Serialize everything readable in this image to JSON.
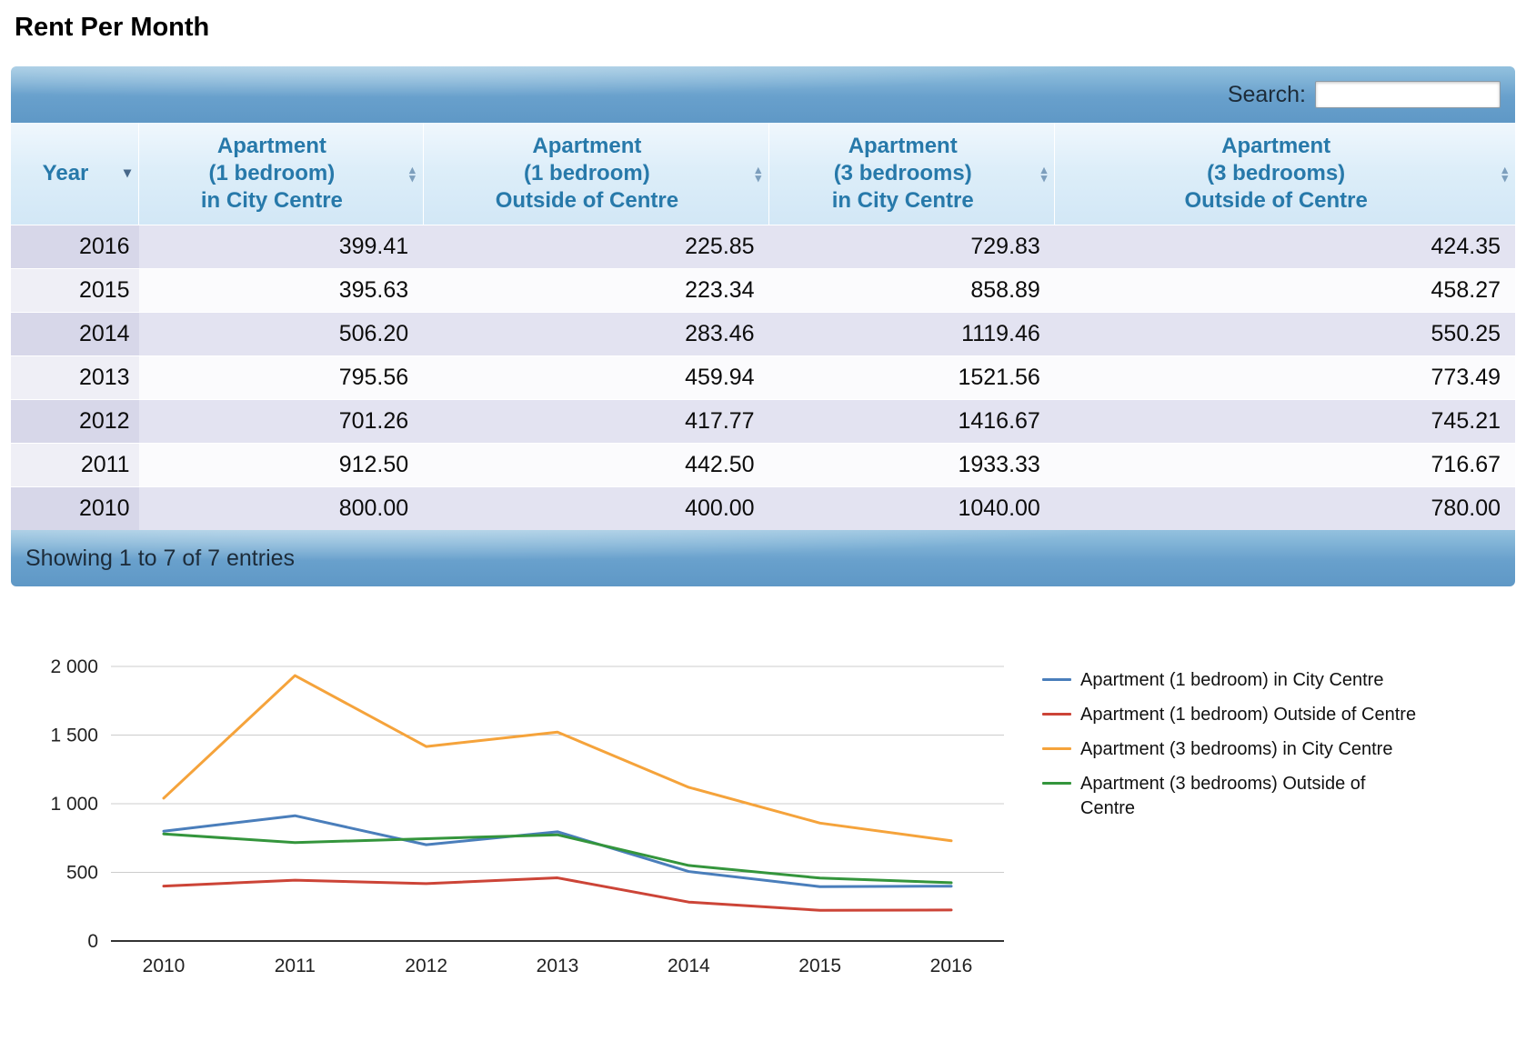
{
  "page": {
    "title": "Rent Per Month"
  },
  "table": {
    "search_label": "Search:",
    "search_value": "",
    "columns": [
      {
        "label": "Year",
        "sort": "desc"
      },
      {
        "label": "Apartment\n(1 bedroom)\nin City Centre",
        "sort": "none"
      },
      {
        "label": "Apartment\n(1 bedroom)\nOutside of Centre",
        "sort": "none"
      },
      {
        "label": "Apartment\n(3 bedrooms)\nin City Centre",
        "sort": "none"
      },
      {
        "label": "Apartment\n(3 bedrooms)\nOutside of Centre",
        "sort": "none"
      }
    ],
    "rows": [
      {
        "year": "2016",
        "values": [
          "399.41",
          "225.85",
          "729.83",
          "424.35"
        ]
      },
      {
        "year": "2015",
        "values": [
          "395.63",
          "223.34",
          "858.89",
          "458.27"
        ]
      },
      {
        "year": "2014",
        "values": [
          "506.20",
          "283.46",
          "1119.46",
          "550.25"
        ]
      },
      {
        "year": "2013",
        "values": [
          "795.56",
          "459.94",
          "1521.56",
          "773.49"
        ]
      },
      {
        "year": "2012",
        "values": [
          "701.26",
          "417.77",
          "1416.67",
          "745.21"
        ]
      },
      {
        "year": "2011",
        "values": [
          "912.50",
          "442.50",
          "1933.33",
          "716.67"
        ]
      },
      {
        "year": "2010",
        "values": [
          "800.00",
          "400.00",
          "1040.00",
          "780.00"
        ]
      }
    ],
    "footer": "Showing 1 to 7 of 7 entries"
  },
  "chart_data": {
    "type": "line",
    "title": "",
    "xlabel": "",
    "ylabel": "",
    "x": [
      "2010",
      "2011",
      "2012",
      "2013",
      "2014",
      "2015",
      "2016"
    ],
    "ylim": [
      0,
      2000
    ],
    "yticks": [
      {
        "label": "0",
        "value": 0
      },
      {
        "label": "500",
        "value": 500
      },
      {
        "label": "1 000",
        "value": 1000
      },
      {
        "label": "1 500",
        "value": 1500
      },
      {
        "label": "2 000",
        "value": 2000
      }
    ],
    "grid": true,
    "legend_position": "right",
    "series": [
      {
        "name": "Apartment (1 bedroom) in City Centre",
        "color": "#4a7ebb",
        "values": [
          800.0,
          912.5,
          701.26,
          795.56,
          506.2,
          395.63,
          399.41
        ]
      },
      {
        "name": "Apartment (1 bedroom) Outside of Centre",
        "color": "#cc4437",
        "values": [
          400.0,
          442.5,
          417.77,
          459.94,
          283.46,
          223.34,
          225.85
        ]
      },
      {
        "name": "Apartment (3 bedrooms) in City Centre",
        "color": "#f5a33b",
        "values": [
          1040.0,
          1933.33,
          1416.67,
          1521.56,
          1119.46,
          858.89,
          729.83
        ]
      },
      {
        "name": "Apartment (3 bedrooms) Outside of Centre",
        "color": "#34953c",
        "values": [
          780.0,
          716.67,
          745.21,
          773.49,
          550.25,
          458.27,
          424.35
        ]
      }
    ]
  }
}
